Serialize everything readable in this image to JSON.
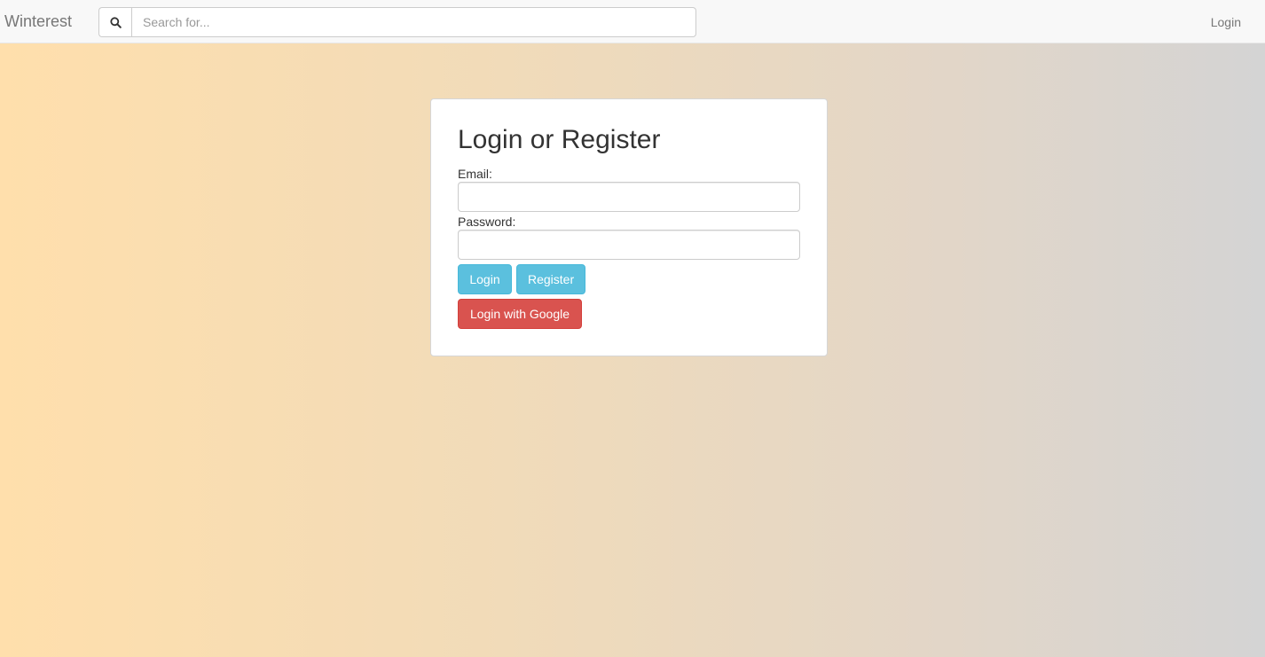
{
  "navbar": {
    "brand": "Winterest",
    "search_placeholder": "Search for...",
    "search_value": "",
    "search_icon": "search-icon",
    "login_link": "Login"
  },
  "login_card": {
    "title": "Login or Register",
    "email_label": "Email:",
    "email_value": "",
    "password_label": "Password:",
    "password_value": "",
    "login_button": "Login",
    "register_button": "Register",
    "google_button": "Login with Google"
  },
  "colors": {
    "background_gradient_start": "#ffdfac",
    "background_gradient_end": "#d4d4d4",
    "info_button": "#5bc0de",
    "danger_button": "#d9534f"
  }
}
